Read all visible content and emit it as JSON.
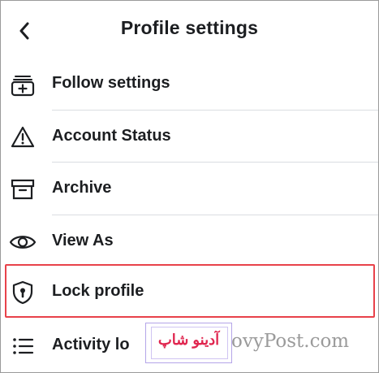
{
  "header": {
    "title": "Profile settings",
    "back_icon": "chevron-left-icon"
  },
  "items": [
    {
      "label": "Follow settings",
      "icon": "add-follow-icon"
    },
    {
      "label": "Account Status",
      "icon": "warning-triangle-icon"
    },
    {
      "label": "Archive",
      "icon": "archive-box-icon"
    },
    {
      "label": "View As",
      "icon": "eye-icon"
    },
    {
      "label": "Lock profile",
      "icon": "shield-keyhole-icon",
      "highlighted": true
    },
    {
      "label": "Activity lo",
      "icon": "list-icon"
    }
  ],
  "watermark": {
    "site_text": "ovyPost.com",
    "brand_text": "آدینو شاپ"
  },
  "colors": {
    "highlight_border": "#e8424a",
    "text": "#1c1e21",
    "separator": "#dadde1",
    "brand": "#e0264f"
  }
}
